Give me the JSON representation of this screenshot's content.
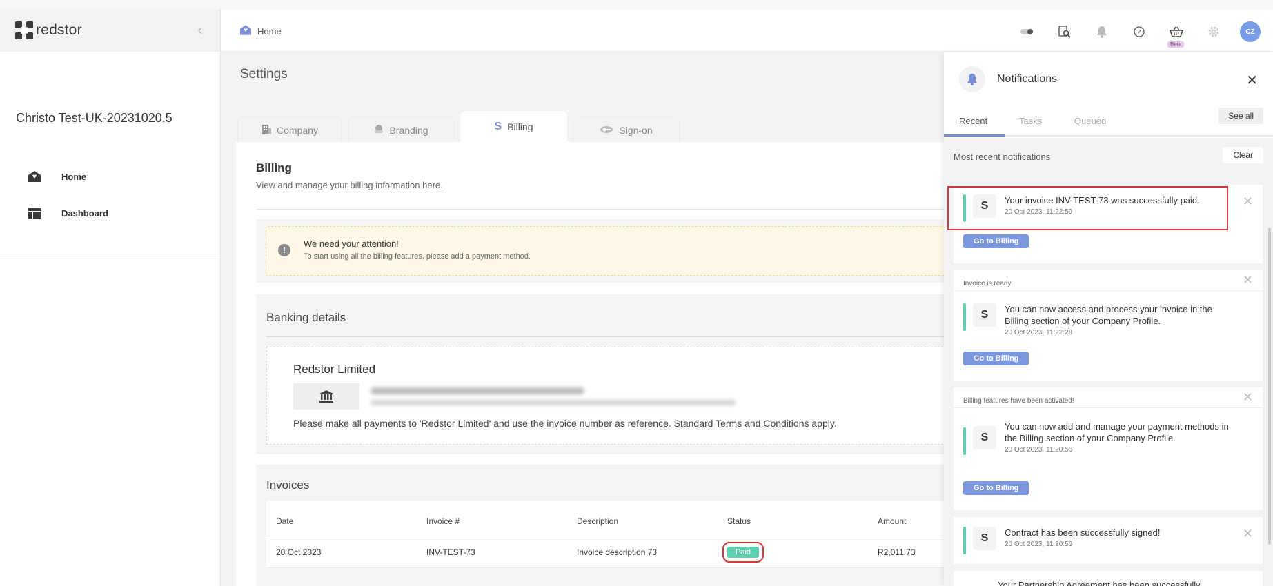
{
  "app": {
    "logo_text": "redstor"
  },
  "sidebar": {
    "company_name": "Christo Test-UK-20231020.5",
    "items": [
      {
        "label": "Home",
        "icon": "home-icon"
      },
      {
        "label": "Dashboard",
        "icon": "dashboard-icon"
      }
    ]
  },
  "header": {
    "breadcrumb": "Home",
    "beta_label": "Beta",
    "avatar_initials": "CZ",
    "icons": [
      "toggle-icon",
      "search-document-icon",
      "bell-icon",
      "help-icon",
      "basket-icon",
      "gear-icon"
    ]
  },
  "page": {
    "title": "Settings",
    "tabs": [
      {
        "label": "Company",
        "icon": "building-icon"
      },
      {
        "label": "Branding",
        "icon": "palette-icon"
      },
      {
        "label": "Billing",
        "icon": "dollar-icon",
        "active": true
      },
      {
        "label": "Sign-on",
        "icon": "cloud-key-icon"
      }
    ]
  },
  "billing": {
    "title": "Billing",
    "subtitle": "View and manage your billing information here.",
    "alert_title": "We need your attention!",
    "alert_text": "To start using all the billing features, please add a payment method.",
    "banking": {
      "title": "Banking details",
      "company": "Redstor Limited",
      "note": "Please make all payments to 'Redstor Limited' and use the invoice number as reference. Standard Terms and Conditions apply."
    },
    "invoices": {
      "title": "Invoices",
      "columns": [
        "Date",
        "Invoice #",
        "Description",
        "Status",
        "Amount"
      ],
      "rows": [
        {
          "date": "20 Oct 2023",
          "invoice": "INV-TEST-73",
          "description": "Invoice description 73",
          "status": "Paid",
          "amount": "R2,011.73"
        }
      ]
    }
  },
  "notifications": {
    "title": "Notifications",
    "tabs": [
      "Recent",
      "Tasks",
      "Queued"
    ],
    "see_all": "See all",
    "section_label": "Most recent notifications",
    "clear": "Clear",
    "items": [
      {
        "header": "",
        "message": "Your invoice INV-TEST-73 was successfully paid.",
        "time": "20 Oct 2023, 11:22:59",
        "button": "Go to Billing"
      },
      {
        "header": "Invoice is ready",
        "message": "You can now access and process your invoice in the Billing section of your Company Profile.",
        "time": "20 Oct 2023, 11:22:28",
        "button": "Go to Billing"
      },
      {
        "header": "Billing features have been activated!",
        "message": "You can now add and manage your payment methods in the Billing section of your Company Profile.",
        "time": "20 Oct 2023, 11:20:56",
        "button": "Go to Billing"
      },
      {
        "header": "",
        "message": "Contract has been successfully signed!",
        "time": "20 Oct 2023, 11:20:56",
        "button": ""
      },
      {
        "header": "",
        "message": "Your Partnership Agreement has been successfully",
        "time": "",
        "button": ""
      }
    ]
  },
  "colors": {
    "accent": "#7b97e0",
    "success": "#5fcfb1",
    "highlight": "#d6383a"
  }
}
